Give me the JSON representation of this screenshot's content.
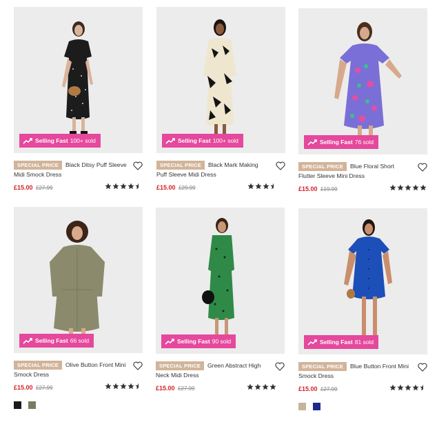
{
  "products": [
    {
      "special": "SPECIAL PRICE",
      "title": "Black Ditsy Puff Sleeve Midi Smock Dress",
      "price": "£15.00",
      "was": "£27.99",
      "selling": "Selling Fast",
      "sold": "100+ sold",
      "rating": 4.5
    },
    {
      "special": "SPECIAL PRICE",
      "title": "Black Mark Making Puff Sleeve Midi Dress",
      "price": "£15.00",
      "was": "£29.99",
      "selling": "Selling Fast",
      "sold": "100+ sold",
      "rating": 3.5
    },
    {
      "special": "SPECIAL PRICE",
      "title": "Blue Floral Short Flutter Sleeve Mini Dress",
      "price": "£15.00",
      "was": "£19.99",
      "selling": "Selling Fast",
      "sold": "76 sold",
      "rating": 5
    },
    {
      "special": "SPECIAL PRICE",
      "title": "Olive Button Front Mini Smock Dress",
      "price": "£15.00",
      "was": "£27.99",
      "selling": "Selling Fast",
      "sold": "66 sold",
      "rating": 4.5,
      "swatches": [
        "#1a1a1a",
        "#7c7a60"
      ]
    },
    {
      "special": "SPECIAL PRICE",
      "title": "Green Abstract High Neck Midi Dress",
      "price": "£15.00",
      "was": "£27.99",
      "selling": "Selling Fast",
      "sold": "90 sold",
      "rating": 4
    },
    {
      "special": "SPECIAL PRICE",
      "title": "Blue Button Front Mini Smock Dress",
      "price": "£15.00",
      "was": "£27.99",
      "selling": "Selling Fast",
      "sold": "81 sold",
      "rating": 4.5,
      "swatches": [
        "#c7b49a",
        "#1b2a8c"
      ]
    }
  ],
  "colors": {
    "badge": "#e5489c",
    "special": "#d2b49a",
    "price": "#d31f26",
    "star": "#333333"
  }
}
